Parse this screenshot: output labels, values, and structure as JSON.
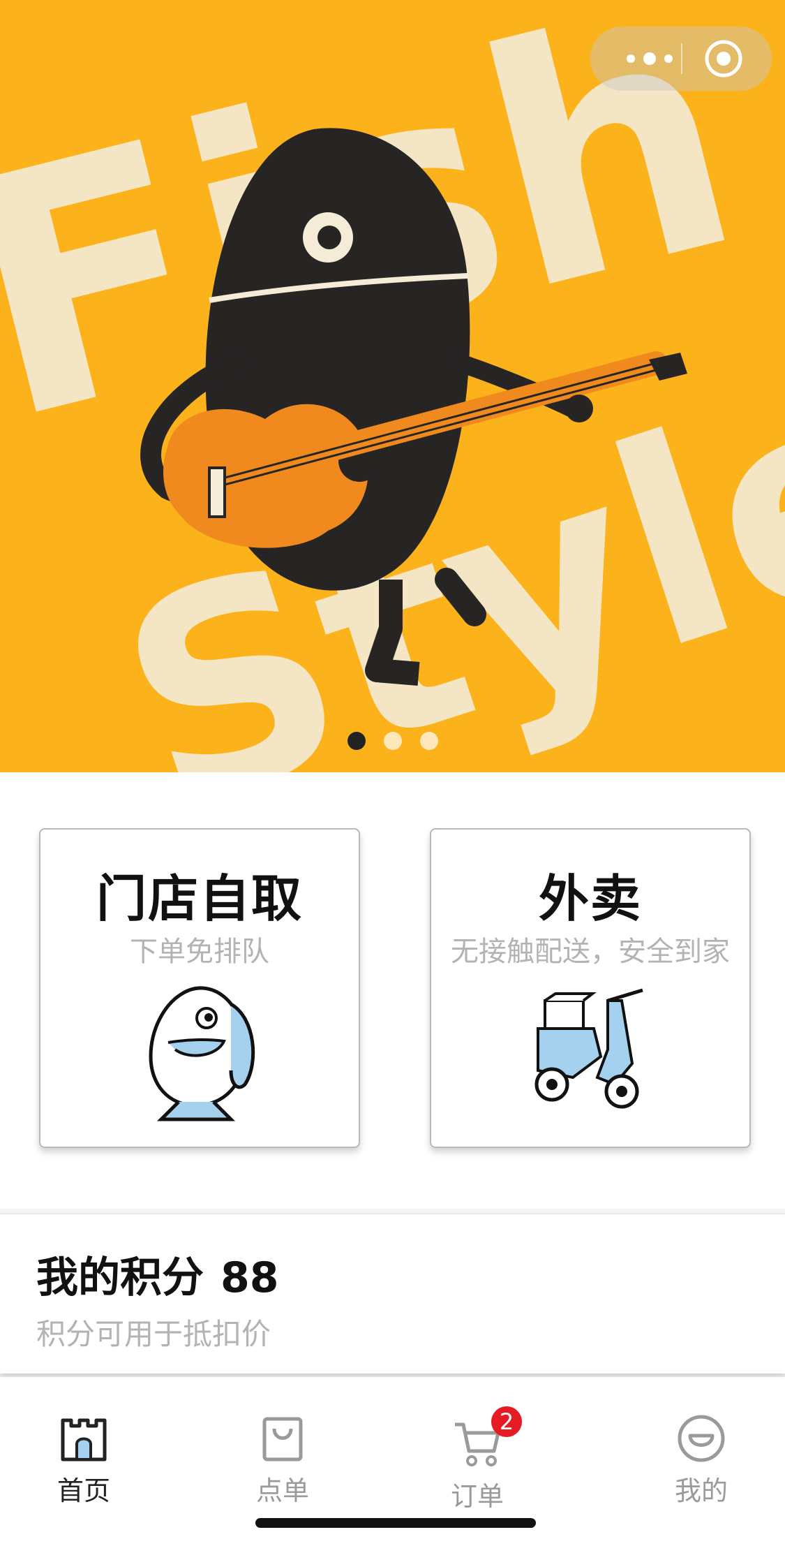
{
  "banner": {
    "art_text_1": "Fish",
    "art_text_2": "Style",
    "slides": 3,
    "active_slide": 1,
    "bg_color": "#fcb21b"
  },
  "capsule": {
    "more_icon": "more-dots-icon",
    "close_icon": "target-icon"
  },
  "cards": [
    {
      "title": "门店自取",
      "subtitle": "下单免排队",
      "icon": "fish-icon"
    },
    {
      "title": "外卖",
      "subtitle": "无接触配送，安全到家",
      "icon": "scooter-icon"
    }
  ],
  "points": {
    "title": "我的积分",
    "value": "88",
    "desc": "积分可用于抵扣价"
  },
  "tabs": [
    {
      "label": "首页",
      "icon": "castle-icon",
      "active": true
    },
    {
      "label": "点单",
      "icon": "bag-icon"
    },
    {
      "label": "订单",
      "icon": "cart-icon",
      "badge": "2"
    },
    {
      "label": "我的",
      "icon": "smile-icon"
    }
  ],
  "colors": {
    "accent_blue": "#a6d1ee",
    "badge_red": "#e51c23"
  }
}
